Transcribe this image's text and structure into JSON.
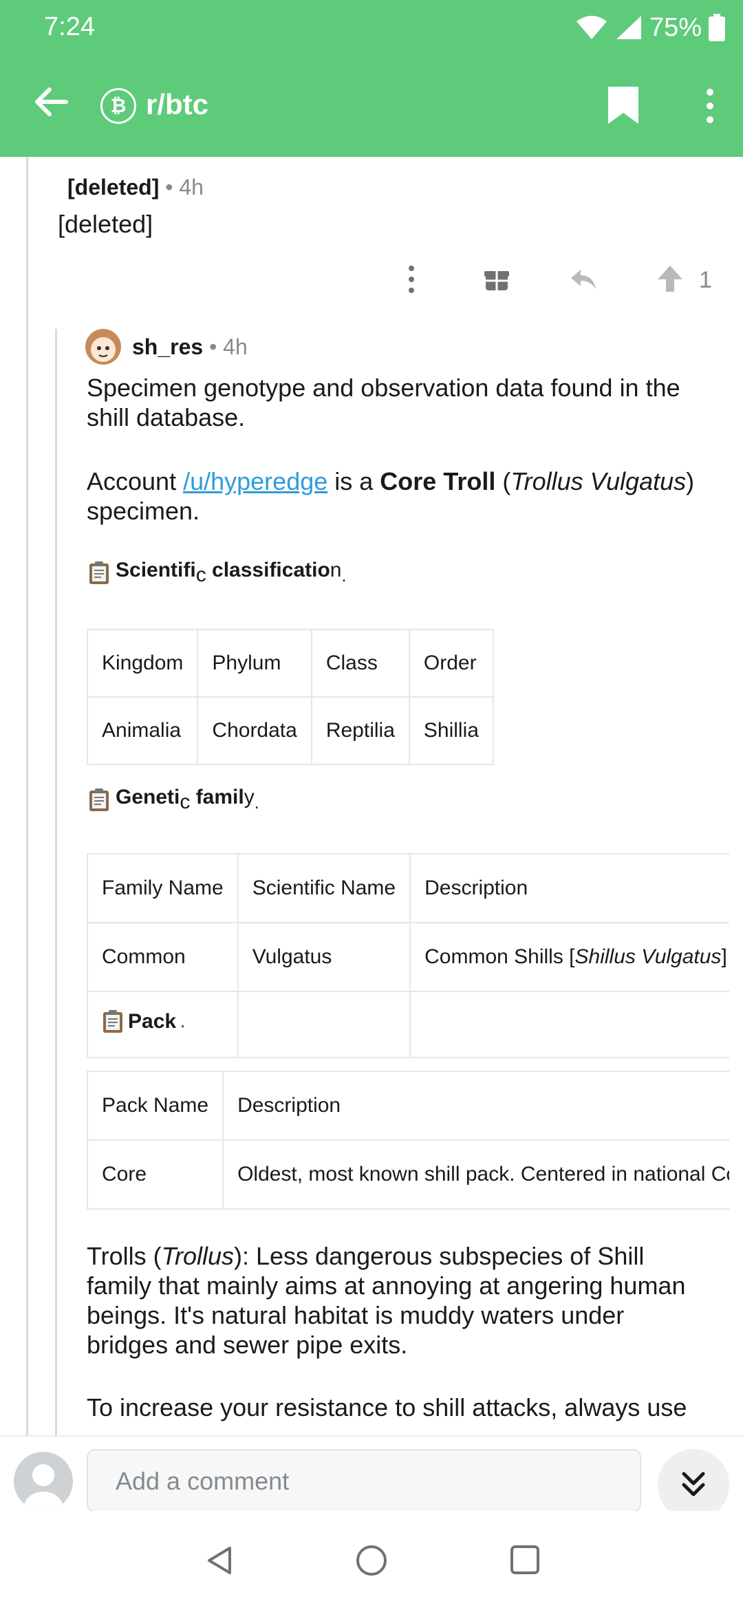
{
  "status_bar": {
    "time": "7:24",
    "battery": "75%"
  },
  "header": {
    "subreddit": "r/btc",
    "subreddit_icon": "bitcoin-icon"
  },
  "parent_comment": {
    "author": "[deleted]",
    "age": "• 4h",
    "body": "[deleted]",
    "upvotes": "1"
  },
  "reply": {
    "author": "sh_res",
    "age": "• 4h",
    "intro_line1": "Specimen genotype and observation data found in the",
    "intro_line2": "shill database.",
    "account_prefix": "Account ",
    "account_link": "/u/hyperedge",
    "account_mid": " is a ",
    "account_bold": "Core Troll",
    "account_paren_open": " (",
    "account_italic": "Trollus Vulgatus",
    "account_paren_close": ")",
    "account_line2": "specimen.",
    "sci_heading": {
      "a": "Scientifi",
      "b": "c",
      "c": " classificatio",
      "d": "n",
      "e": "."
    },
    "sci_table": {
      "headers": [
        "Kingdom",
        "Phylum",
        "Class",
        "Order"
      ],
      "row": [
        "Animalia",
        "Chordata",
        "Reptilia",
        "Shillia"
      ]
    },
    "gen_heading": {
      "a": "Geneti",
      "b": "c",
      "c": " famil",
      "d": "y",
      "e": "."
    },
    "gen_table": {
      "headers": [
        "Family Name",
        "Scientific Name",
        "Description"
      ],
      "row": [
        "Common",
        "Vulgatus",
        "Common Shills ["
      ],
      "row_italic": "Shillus Vulgatus",
      "row_tail": "] a",
      "pack_label": "Pack",
      "pack_dot": "."
    },
    "pack_table": {
      "headers": [
        "Pack Name",
        "Description"
      ],
      "row": [
        "Core",
        "Oldest, most known shill pack. Centered in national Cor"
      ]
    },
    "trolls_para": {
      "a": "Trolls (",
      "italic": "Trollus",
      "b": "): Less dangerous subspecies of Shill",
      "line2": "family that mainly aims at annoying at angering human",
      "line3": "beings. It's natural habitat is muddy waters under",
      "line4": "bridges and sewer pipe exits."
    },
    "resistance_line": "To increase your resistance to shill attacks, always use"
  },
  "bottom_bar": {
    "comment_placeholder": "Add a comment"
  },
  "colors": {
    "header_green": "#5ecb7a",
    "link_blue": "#2d9cdb"
  },
  "icons": [
    "back-arrow-icon",
    "bitcoin-icon",
    "bookmark-icon",
    "kebab-menu-icon",
    "more-icon",
    "gift-icon",
    "reply-icon",
    "upvote-icon",
    "avatar",
    "clipboard-icon",
    "double-chevron-down-icon",
    "nav-back-icon",
    "nav-home-icon",
    "nav-recents-icon"
  ]
}
